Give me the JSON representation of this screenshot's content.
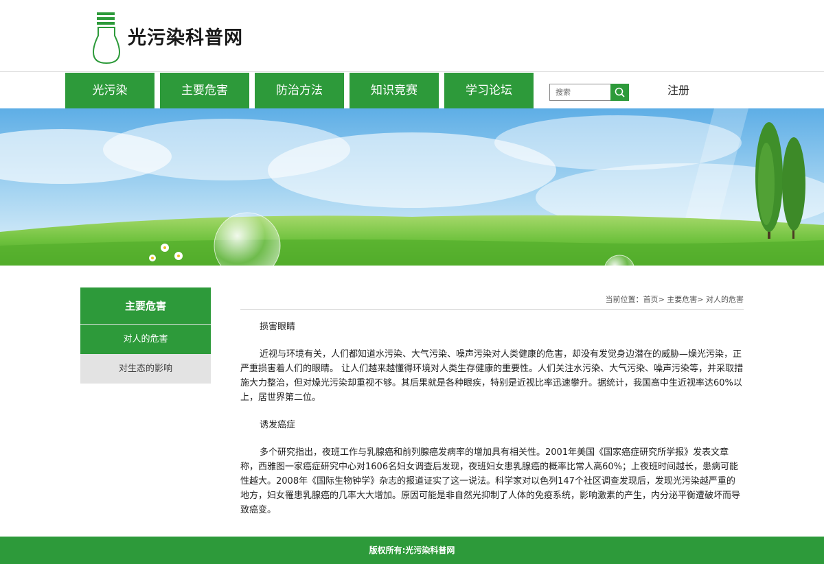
{
  "site": {
    "title": "光污染科普网"
  },
  "nav": {
    "items": [
      {
        "label": "光污染"
      },
      {
        "label": "主要危害"
      },
      {
        "label": "防治方法"
      },
      {
        "label": "知识竞赛"
      },
      {
        "label": "学习论坛"
      }
    ],
    "search_placeholder": "搜索",
    "register_label": "注册"
  },
  "colors": {
    "brand_green": "#2d9a3a",
    "sidebar_inactive": "#e3e3e3"
  },
  "sidebar": {
    "heading": "主要危害",
    "items": [
      {
        "label": "对人的危害",
        "active": true
      },
      {
        "label": "对生态的影响",
        "active": false
      }
    ]
  },
  "breadcrumb": {
    "prefix": "当前位置：",
    "home": "首页",
    "level1": "主要危害",
    "level2": "对人的危害",
    "separator": ">"
  },
  "article": {
    "section1_title": "损害眼睛",
    "section1_body": "近视与环境有关，人们都知道水污染、大气污染、噪声污染对人类健康的危害，却没有发觉身边潜在的威胁—燥光污染，正严重损害着人们的眼睛。 让人们越来越懂得环境对人类生存健康的重要性。人们关注水污染、大气污染、噪声污染等，并采取措施大力整治，但对燥光污染却重视不够。其后果就是各种眼疾，特别是近视比率迅速攀升。据统计，我国高中生近视率达60%以上，居世界第二位。",
    "section2_title": "诱发癌症",
    "section2_body": "多个研究指出，夜班工作与乳腺癌和前列腺癌发病率的增加具有相关性。2001年美国《国家癌症研究所学报》发表文章称，西雅图一家癌症研究中心对1606名妇女调查后发现，夜班妇女患乳腺癌的概率比常人高60%；上夜班时间越长，患病可能性越大。2008年《国际生物钟学》杂志的报道证实了这一说法。科学家对以色列147个社区调查发现后，发现光污染越严重的地方，妇女罹患乳腺癌的几率大大增加。原因可能是非自然光抑制了人体的免疫系统，影响激素的产生，内分泌平衡遭破坏而导致癌变。"
  },
  "footer": {
    "copyright": "版权所有:光污染科普网"
  }
}
